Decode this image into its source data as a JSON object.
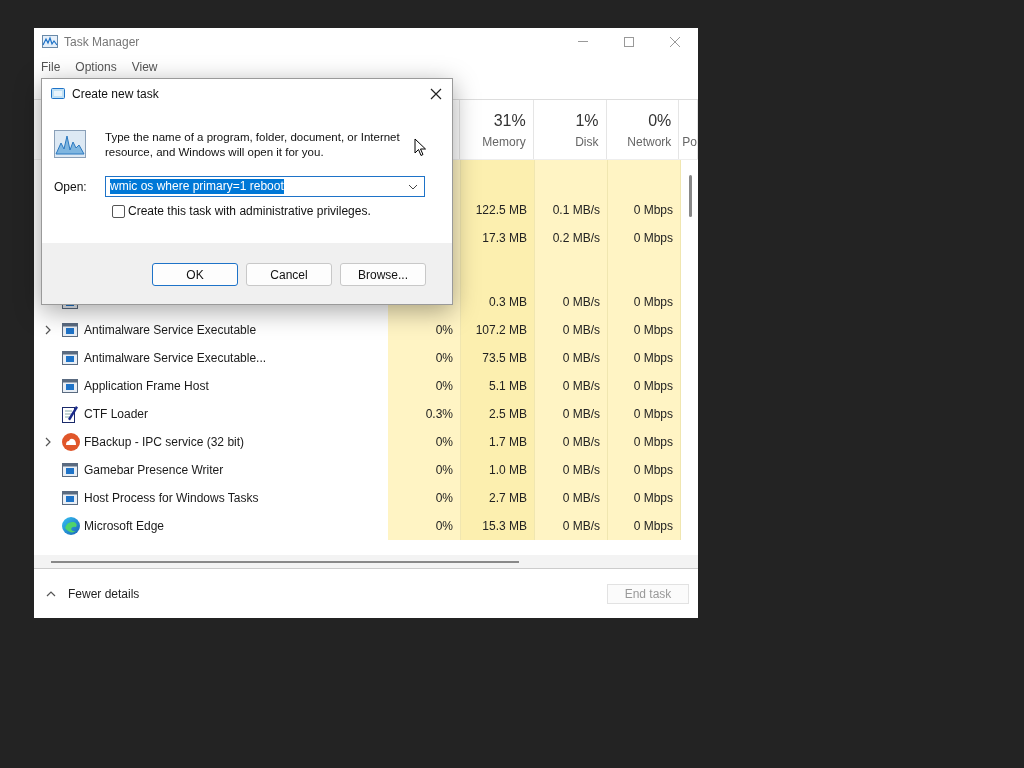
{
  "window": {
    "title": "Task Manager"
  },
  "menu": [
    "File",
    "Options",
    "View"
  ],
  "columns": [
    {
      "percent": "31%",
      "label": "Memory"
    },
    {
      "percent": "1%",
      "label": "Disk"
    },
    {
      "percent": "0%",
      "label": "Network"
    },
    {
      "label": "Po"
    }
  ],
  "rows": [
    {
      "kind": "group"
    },
    {
      "kind": "hidden",
      "memory": "122.5 MB",
      "disk": "0.1 MB/s",
      "network": "0 Mbps"
    },
    {
      "kind": "hidden",
      "memory": "17.3 MB",
      "disk": "0.2 MB/s",
      "network": "0 Mbps"
    },
    {
      "kind": "group"
    },
    {
      "kind": "window",
      "expandable": false,
      "memory": "0.3 MB",
      "disk": "0 MB/s",
      "network": "0 Mbps"
    },
    {
      "kind": "window",
      "name": "Antimalware Service Executable",
      "expandable": true,
      "cpu": "0%",
      "memory": "107.2 MB",
      "disk": "0 MB/s",
      "network": "0 Mbps"
    },
    {
      "kind": "window",
      "name": "Antimalware Service Executable...",
      "expandable": false,
      "cpu": "0%",
      "memory": "73.5 MB",
      "disk": "0 MB/s",
      "network": "0 Mbps"
    },
    {
      "kind": "window",
      "name": "Application Frame Host",
      "expandable": false,
      "cpu": "0%",
      "memory": "5.1 MB",
      "disk": "0 MB/s",
      "network": "0 Mbps"
    },
    {
      "kind": "editor",
      "name": "CTF Loader",
      "expandable": false,
      "cpu": "0.3%",
      "memory": "2.5 MB",
      "disk": "0 MB/s",
      "network": "0 Mbps"
    },
    {
      "kind": "backup",
      "name": "FBackup - IPC service (32 bit)",
      "expandable": true,
      "cpu": "0%",
      "memory": "1.7 MB",
      "disk": "0 MB/s",
      "network": "0 Mbps"
    },
    {
      "kind": "window",
      "name": "Gamebar Presence Writer",
      "expandable": false,
      "cpu": "0%",
      "memory": "1.0 MB",
      "disk": "0 MB/s",
      "network": "0 Mbps"
    },
    {
      "kind": "window",
      "name": "Host Process for Windows Tasks",
      "expandable": false,
      "cpu": "0%",
      "memory": "2.7 MB",
      "disk": "0 MB/s",
      "network": "0 Mbps"
    },
    {
      "kind": "browser",
      "name": "Microsoft Edge",
      "expandable": false,
      "cpu": "0%",
      "memory": "15.3 MB",
      "disk": "0 MB/s",
      "network": "0 Mbps"
    }
  ],
  "footer": {
    "details_toggle": "Fewer details",
    "end_task": {
      "label": "End task",
      "disabled": true
    }
  },
  "dialog": {
    "title": "Create new task",
    "message": "Type the name of a program, folder, document, or Internet resource, and Windows will open it for you.",
    "open_label": "Open:",
    "open_value": "wmic os where primary=1 reboot",
    "admin_checkbox": {
      "label": "Create this task with administrative privileges.",
      "checked": false
    },
    "buttons": [
      {
        "label": "OK",
        "default": true
      },
      {
        "label": "Cancel",
        "default": false
      },
      {
        "label": "Browse...",
        "default": false
      }
    ]
  }
}
